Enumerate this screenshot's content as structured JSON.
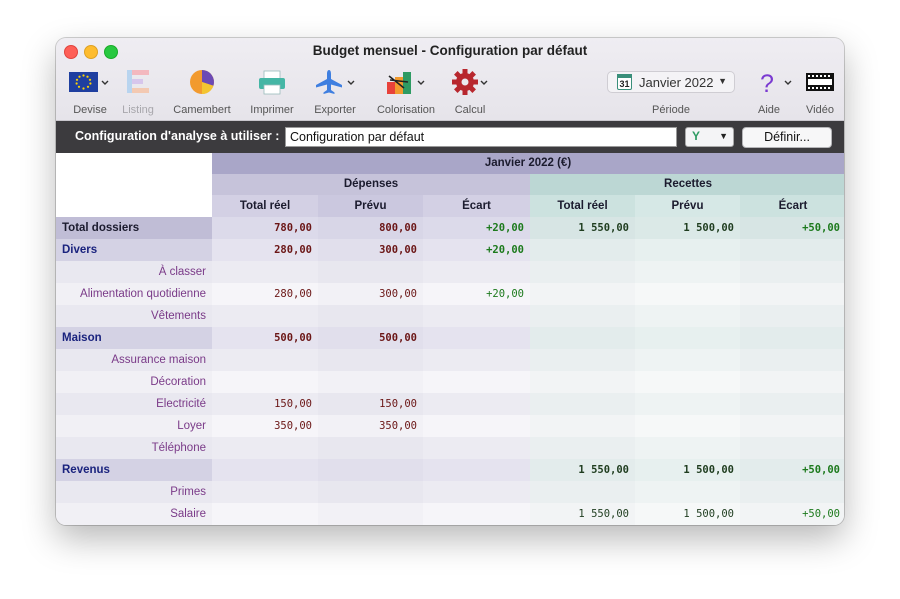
{
  "window": {
    "title": "Budget mensuel - Configuration par défaut"
  },
  "toolbar": {
    "devise": "Devise",
    "listing": "Listing",
    "camembert": "Camembert",
    "imprimer": "Imprimer",
    "exporter": "Exporter",
    "colorisation": "Colorisation",
    "calcul": "Calcul",
    "periode_value": "Janvier 2022",
    "periode_label": "Période",
    "calendar_day": "31",
    "aide": "Aide",
    "video": "Vidéo"
  },
  "config": {
    "label": "Configuration d'analyse à utiliser :",
    "value": "Configuration par défaut",
    "button": "Définir..."
  },
  "table": {
    "period_header": "Janvier 2022 (€)",
    "group_depenses": "Dépenses",
    "group_recettes": "Recettes",
    "columns": [
      "Total réel",
      "Prévu",
      "Écart",
      "Total réel",
      "Prévu",
      "Écart"
    ],
    "rows": [
      {
        "label": "Total dossiers",
        "kind": "total",
        "values": [
          "780,00",
          "800,00",
          "+20,00",
          "1 550,00",
          "1 500,00",
          "+50,00"
        ]
      },
      {
        "label": "Divers",
        "kind": "group",
        "values": [
          "280,00",
          "300,00",
          "+20,00",
          "",
          "",
          ""
        ]
      },
      {
        "label": "À classer",
        "kind": "item",
        "values": [
          "",
          "",
          "",
          "",
          "",
          ""
        ]
      },
      {
        "label": "Alimentation quotidienne",
        "kind": "item",
        "values": [
          "280,00",
          "300,00",
          "+20,00",
          "",
          "",
          ""
        ]
      },
      {
        "label": "Vêtements",
        "kind": "item",
        "values": [
          "",
          "",
          "",
          "",
          "",
          ""
        ]
      },
      {
        "label": "Maison",
        "kind": "group",
        "values": [
          "500,00",
          "500,00",
          "",
          "",
          "",
          ""
        ]
      },
      {
        "label": "Assurance maison",
        "kind": "item",
        "values": [
          "",
          "",
          "",
          "",
          "",
          ""
        ]
      },
      {
        "label": "Décoration",
        "kind": "item",
        "values": [
          "",
          "",
          "",
          "",
          "",
          ""
        ]
      },
      {
        "label": "Electricité",
        "kind": "item",
        "values": [
          "150,00",
          "150,00",
          "",
          "",
          "",
          ""
        ]
      },
      {
        "label": "Loyer",
        "kind": "item",
        "values": [
          "350,00",
          "350,00",
          "",
          "",
          "",
          ""
        ]
      },
      {
        "label": "Téléphone",
        "kind": "item",
        "values": [
          "",
          "",
          "",
          "",
          "",
          ""
        ]
      },
      {
        "label": "Revenus",
        "kind": "group",
        "values": [
          "",
          "",
          "",
          "1 550,00",
          "1 500,00",
          "+50,00"
        ]
      },
      {
        "label": "Primes",
        "kind": "item",
        "values": [
          "",
          "",
          "",
          "",
          "",
          ""
        ]
      },
      {
        "label": "Salaire",
        "kind": "item",
        "values": [
          "",
          "",
          "",
          "1 550,00",
          "1 500,00",
          "+50,00"
        ]
      }
    ]
  },
  "colors": {
    "depense_value": "#6b1616",
    "recette_value": "#1f3d1f",
    "ecart_positive": "#1d7a1d",
    "label_group": "#1a237e",
    "label_item": "#7a3a88"
  }
}
